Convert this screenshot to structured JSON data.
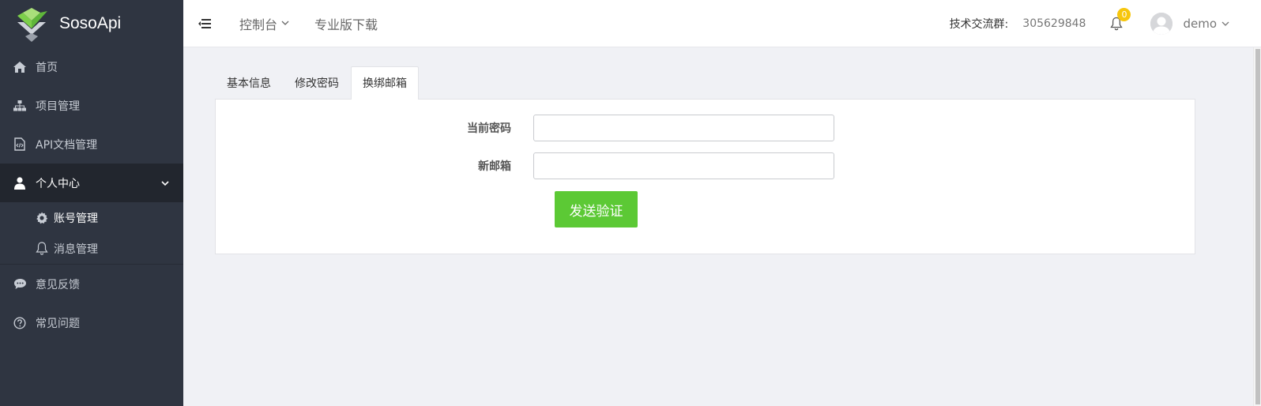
{
  "app": {
    "name": "SosoApi"
  },
  "sidebar": {
    "items": [
      {
        "label": "首页",
        "icon": "home-icon"
      },
      {
        "label": "项目管理",
        "icon": "sitemap-icon"
      },
      {
        "label": "API文档管理",
        "icon": "code-file-icon"
      },
      {
        "label": "个人中心",
        "icon": "user-icon",
        "active": true
      },
      {
        "label": "意见反馈",
        "icon": "comment-icon"
      },
      {
        "label": "常见问题",
        "icon": "question-circle-icon"
      }
    ],
    "sub_items": [
      {
        "label": "账号管理",
        "icon": "gear-icon",
        "active": true
      },
      {
        "label": "消息管理",
        "icon": "bell-icon"
      }
    ]
  },
  "topbar": {
    "console": "控制台",
    "pro_download": "专业版下载",
    "group_label": "技术交流群:",
    "group_number": "305629848",
    "notification_count": "0",
    "username": "demo"
  },
  "tabs": [
    {
      "label": "基本信息"
    },
    {
      "label": "修改密码"
    },
    {
      "label": "换绑邮箱",
      "active": true
    }
  ],
  "form": {
    "current_password_label": "当前密码",
    "current_password_value": "",
    "new_email_label": "新邮箱",
    "new_email_value": "",
    "submit_label": "发送验证"
  },
  "colors": {
    "sidebar_bg": "#2f3541",
    "sidebar_active_bg": "#22262e",
    "accent_green": "#5cc935",
    "badge_yellow": "#f7c60d",
    "page_bg": "#f0f1f5"
  }
}
